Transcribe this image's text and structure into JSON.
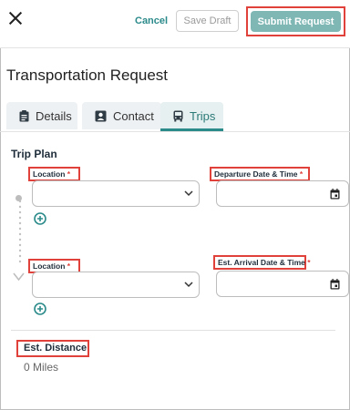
{
  "header": {
    "cancel_label": "Cancel",
    "save_draft_label": "Save Draft",
    "submit_label": "Submit Request"
  },
  "page": {
    "title": "Transportation Request"
  },
  "tabs": [
    {
      "label": "Details",
      "icon": "clipboard-icon"
    },
    {
      "label": "Contact",
      "icon": "contact-card-icon"
    },
    {
      "label": "Trips",
      "icon": "bus-icon",
      "active": true
    }
  ],
  "trip_plan": {
    "title": "Trip Plan",
    "stops": [
      {
        "location_label": "Location",
        "date_label": "Departure Date & Time",
        "required_mark": "*"
      },
      {
        "location_label": "Location",
        "date_label": "Est. Arrival Date & Time",
        "required_mark": "*"
      }
    ]
  },
  "distance": {
    "label": "Est. Distance",
    "value": "0 Miles"
  },
  "colors": {
    "accent": "#2b8a8a",
    "submit_bg": "#7fb7b5",
    "highlight": "#e0413b"
  }
}
